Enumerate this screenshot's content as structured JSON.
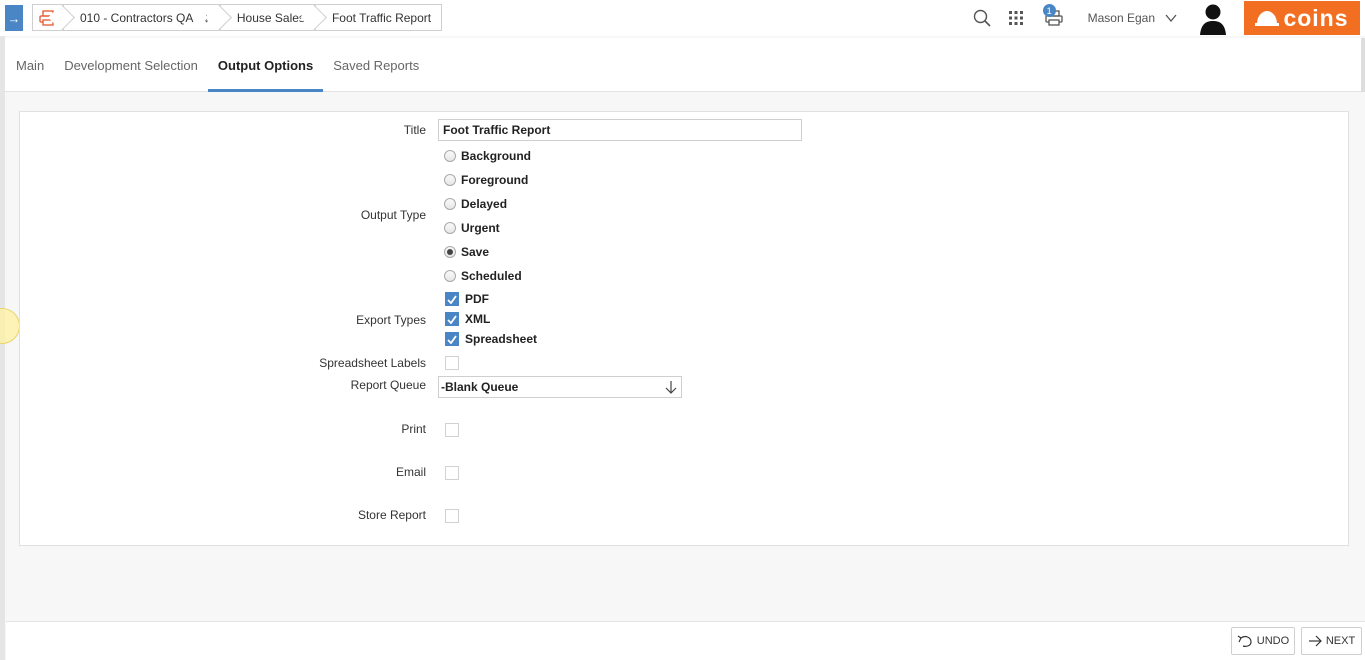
{
  "breadcrumbs": [
    {
      "label": "010 - Contractors QA",
      "has_dropdown": true
    },
    {
      "label": "House Sales"
    },
    {
      "label": "Foot Traffic Report"
    }
  ],
  "header": {
    "print_queue_count": "1",
    "user_name": "Mason Egan",
    "logo_text": "coins",
    "brand_color": "#f26f21",
    "accent_color": "#4a86c5",
    "icons": [
      "search-icon",
      "apps-grid-icon",
      "print-queue-icon",
      "chevron-down-icon",
      "user-icon"
    ]
  },
  "tabs": [
    {
      "label": "Main",
      "active": false
    },
    {
      "label": "Development Selection",
      "active": false
    },
    {
      "label": "Output Options",
      "active": true
    },
    {
      "label": "Saved Reports",
      "active": false
    }
  ],
  "form": {
    "title_label": "Title",
    "title_value": "Foot Traffic Report",
    "output_type_label": "Output Type",
    "output_types": [
      {
        "label": "Background",
        "selected": false
      },
      {
        "label": "Foreground",
        "selected": false
      },
      {
        "label": "Delayed",
        "selected": false
      },
      {
        "label": "Urgent",
        "selected": false
      },
      {
        "label": "Save",
        "selected": true
      },
      {
        "label": "Scheduled",
        "selected": false
      }
    ],
    "export_types_label": "Export Types",
    "export_types": [
      {
        "label": "PDF",
        "checked": true
      },
      {
        "label": "XML",
        "checked": true
      },
      {
        "label": "Spreadsheet",
        "checked": true
      }
    ],
    "spreadsheet_labels_label": "Spreadsheet Labels",
    "spreadsheet_labels_checked": false,
    "report_queue_label": "Report Queue",
    "report_queue_value": "-Blank Queue",
    "print_label": "Print",
    "print_checked": false,
    "email_label": "Email",
    "email_checked": false,
    "store_report_label": "Store Report",
    "store_report_checked": false
  },
  "footer": {
    "undo_label": "UNDO",
    "next_label": "NEXT"
  }
}
